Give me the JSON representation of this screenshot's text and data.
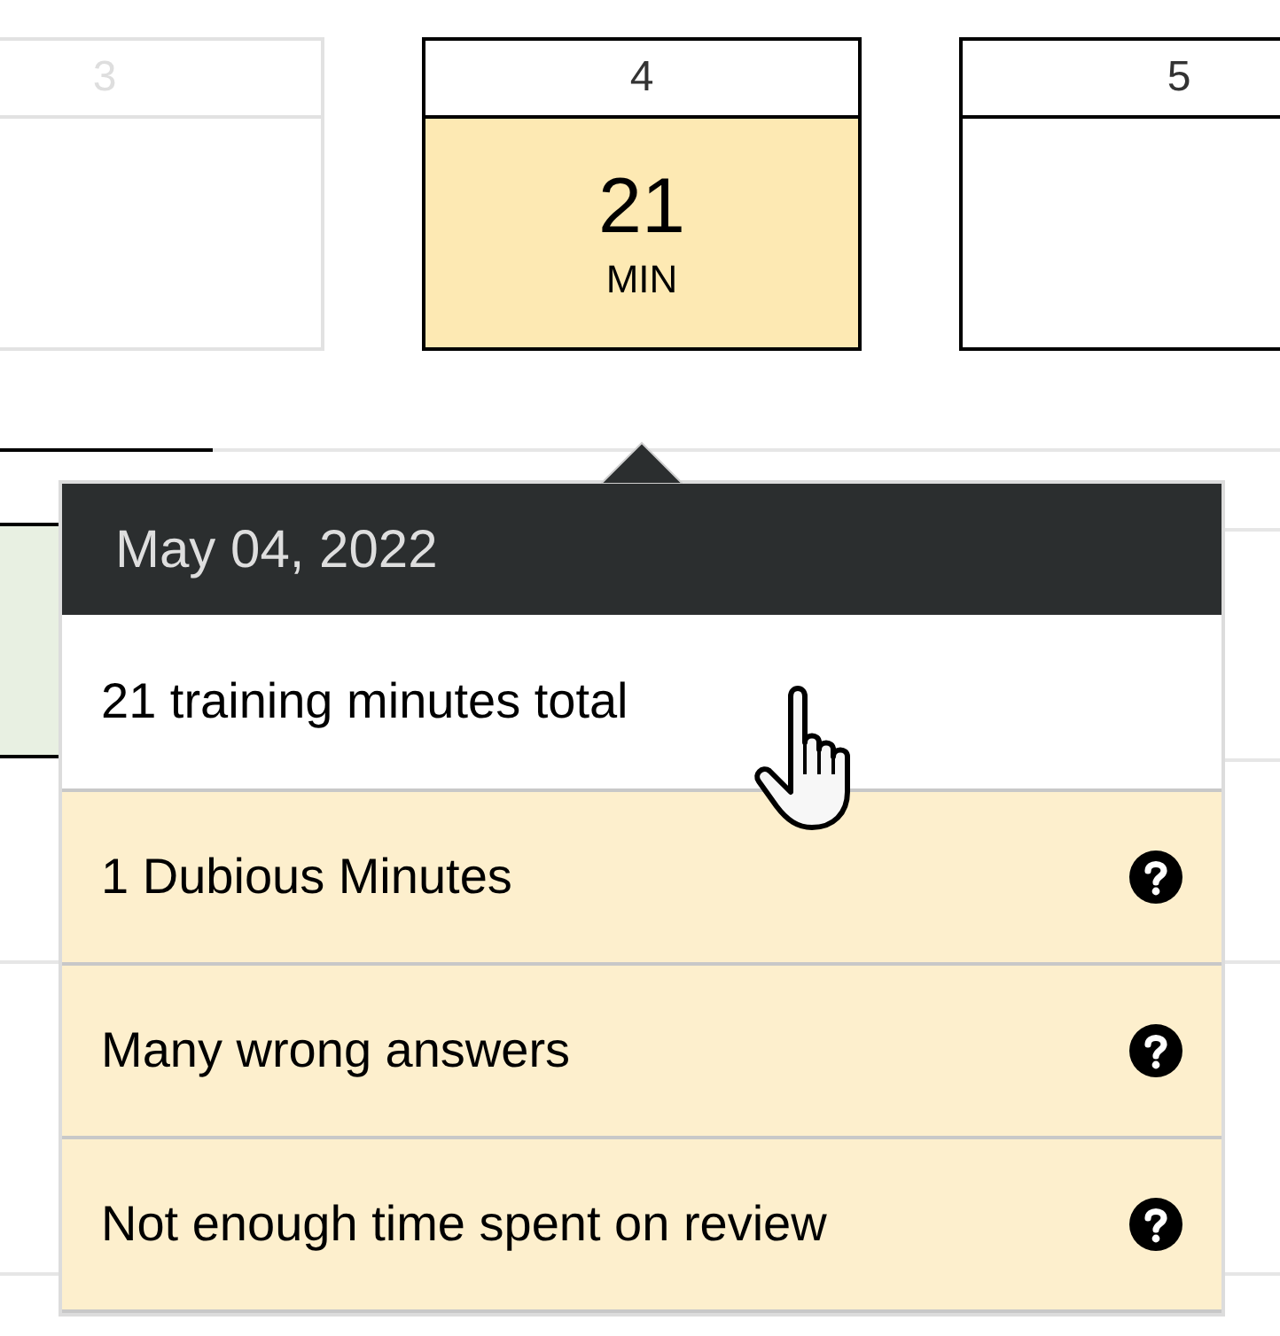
{
  "days": [
    {
      "label": "3",
      "faded": true,
      "selected": false
    },
    {
      "label": "4",
      "faded": false,
      "selected": true,
      "minutes": "21",
      "unit": "MIN"
    },
    {
      "label": "5",
      "faded": false,
      "selected": false
    }
  ],
  "popover": {
    "date": "May 04, 2022",
    "total": "21 training minutes total",
    "flags": [
      {
        "text": "1 Dubious Minutes"
      },
      {
        "text": "Many wrong answers"
      },
      {
        "text": "Not enough time spent on review"
      }
    ]
  }
}
